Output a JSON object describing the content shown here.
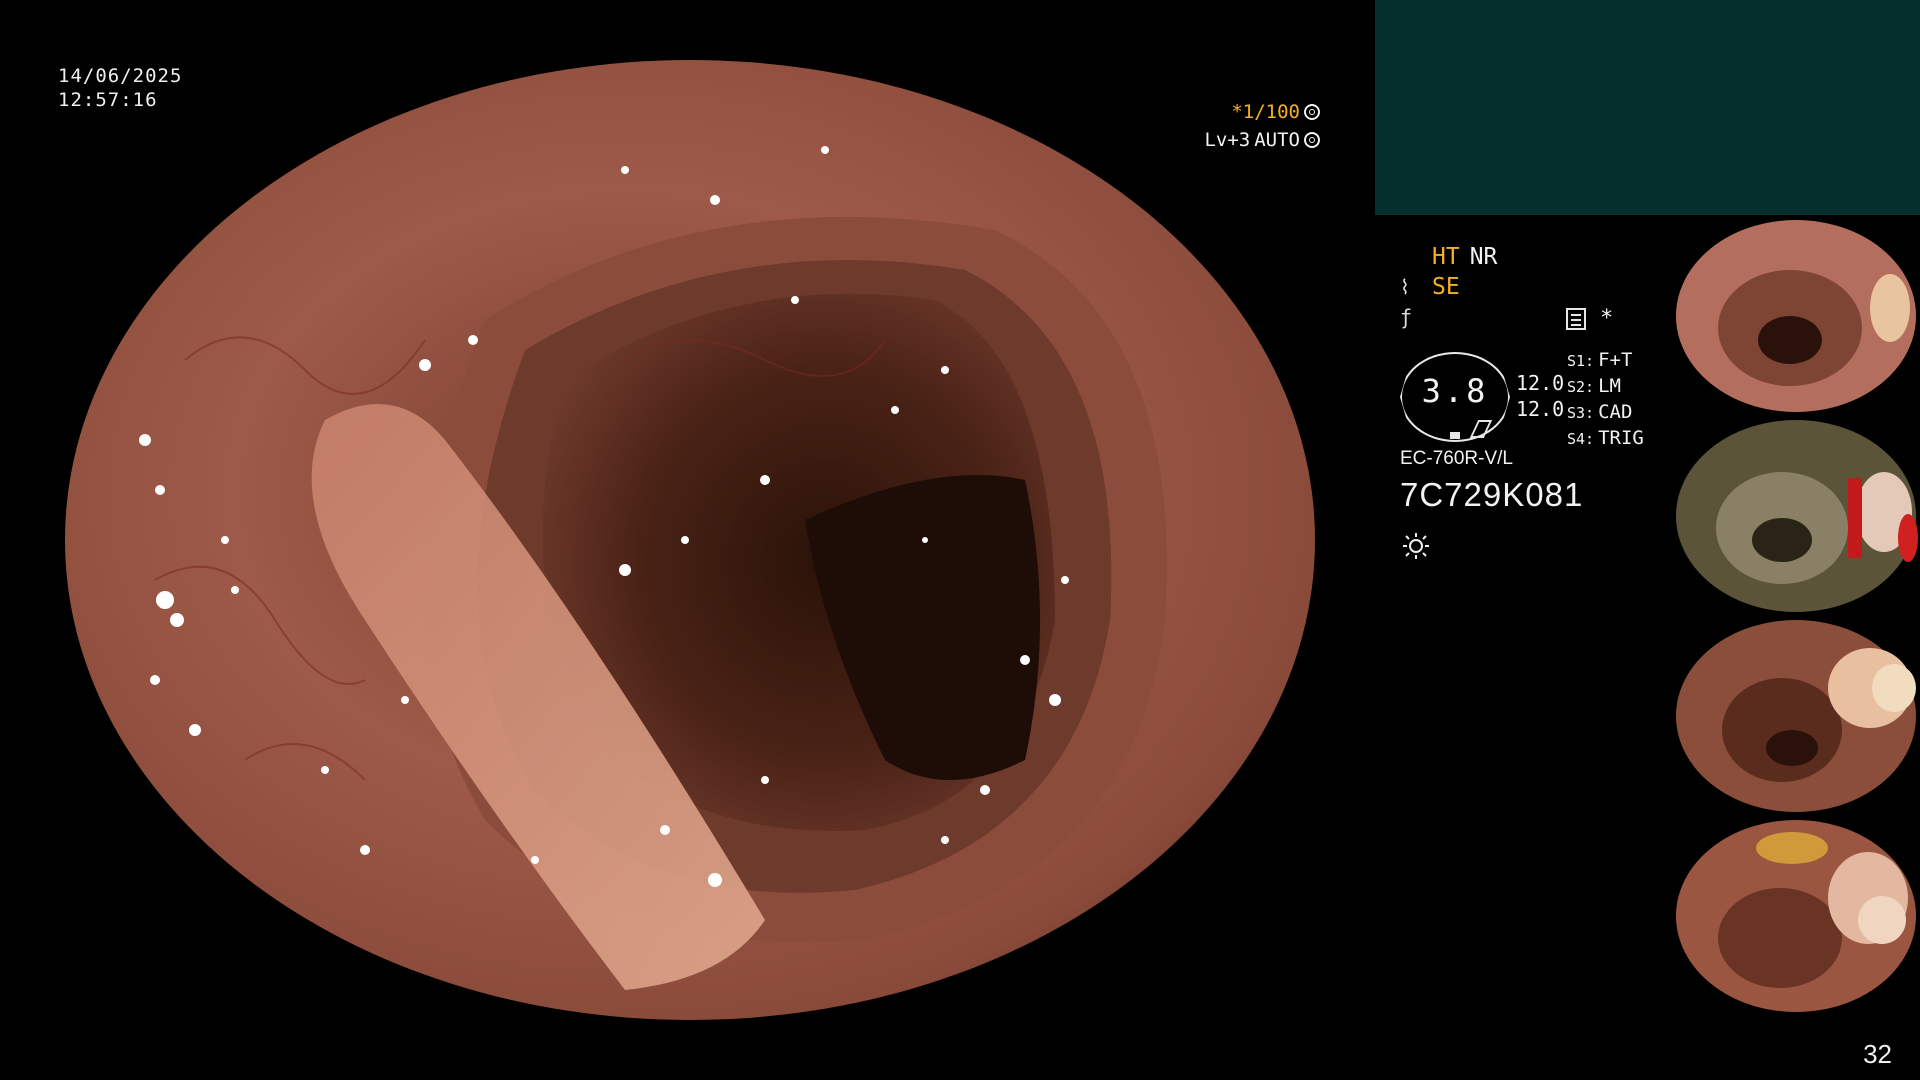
{
  "overlay": {
    "date": "14/06/2025",
    "time": "12:57:16",
    "shutter": "*1/100",
    "level": "Lv+3",
    "iris": "AUTO"
  },
  "panel": {
    "mode_ht": "HT",
    "mode_nr": "NR",
    "mode_se": "SE",
    "mode_f": "f",
    "star": "*",
    "gauge_value": "3.8",
    "levels": [
      "12.0",
      "12.0"
    ],
    "scope_switches": [
      {
        "label": "S1:",
        "value": "F+T"
      },
      {
        "label": "S2:",
        "value": "LM"
      },
      {
        "label": "S3:",
        "value": "CAD"
      },
      {
        "label": "S4:",
        "value": "TRIG"
      }
    ],
    "model": "EC-760R-V/L",
    "serial": "7C729K081"
  },
  "page_number": "32",
  "colors": {
    "accent_orange": "#f5b023",
    "teal_panel": "#052f2d",
    "mucosa": "#a86553"
  },
  "icons": [
    "shutter-icon",
    "iris-icon",
    "document-icon",
    "sun-icon"
  ]
}
